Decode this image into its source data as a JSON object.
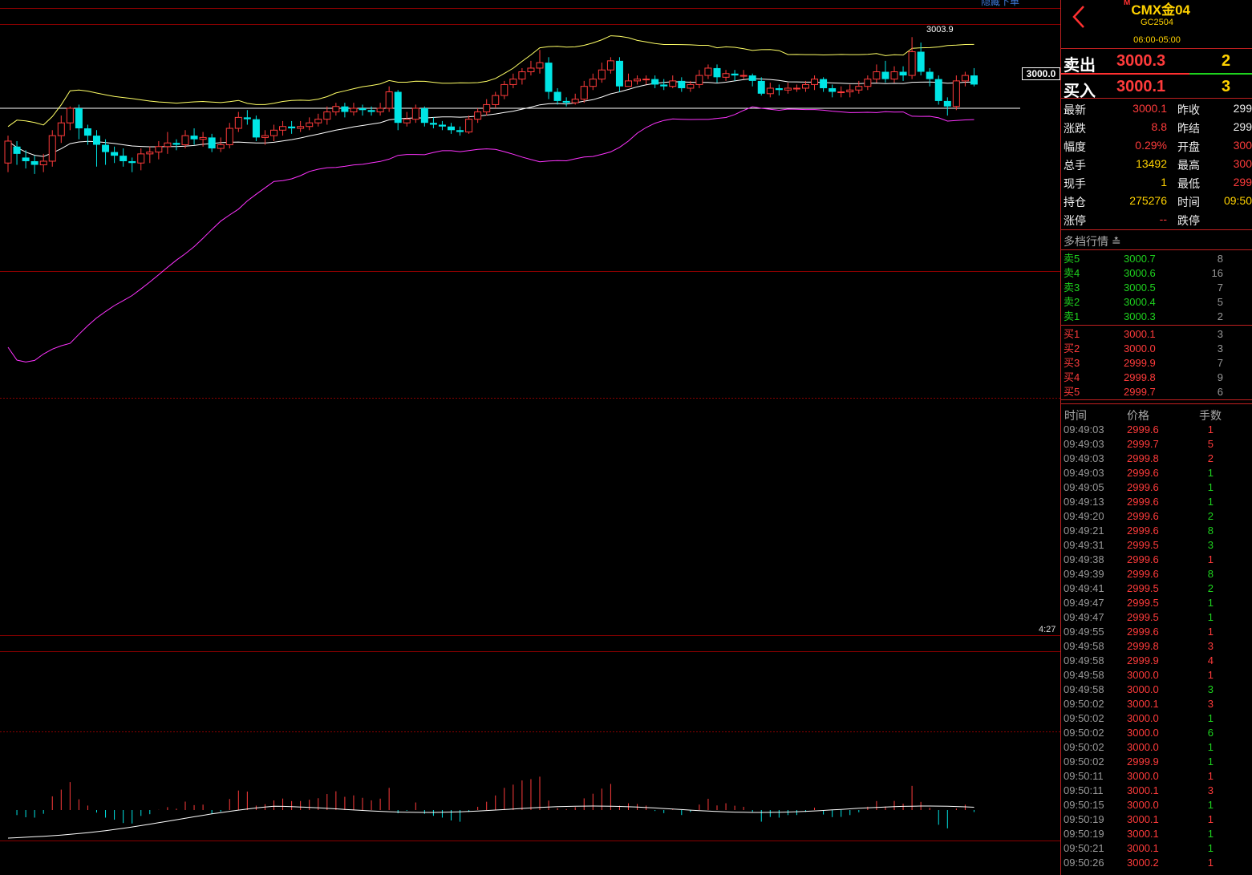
{
  "header": {
    "marker": "M",
    "name": "CMX金04",
    "code": "GC2504",
    "hours": "06:00-05:00"
  },
  "chart": {
    "hidden_orders_label": "隐藏下单",
    "high_label": "3003.9",
    "current_price_tag": "3000.0",
    "time_label": "4:27",
    "candles": [
      {
        "o": 2997.0,
        "c": 2998.2,
        "h": 2998.5,
        "l": 2996.5
      },
      {
        "o": 2997.9,
        "c": 2997.5,
        "h": 2998.2,
        "l": 2996.9
      },
      {
        "o": 2997.3,
        "c": 2997.1,
        "h": 2997.7,
        "l": 2996.7
      },
      {
        "o": 2997.1,
        "c": 2996.9,
        "h": 2997.4,
        "l": 2996.4
      },
      {
        "o": 2996.9,
        "c": 2997.1,
        "h": 2997.5,
        "l": 2996.5
      },
      {
        "o": 2997.1,
        "c": 2998.5,
        "h": 2998.8,
        "l": 2996.8
      },
      {
        "o": 2998.5,
        "c": 2999.2,
        "h": 2999.6,
        "l": 2998.1
      },
      {
        "o": 2999.2,
        "c": 3000.0,
        "h": 3000.1,
        "l": 2998.8
      },
      {
        "o": 3000.0,
        "c": 2998.9,
        "h": 3000.2,
        "l": 2998.3
      },
      {
        "o": 2998.9,
        "c": 2998.5,
        "h": 2999.1,
        "l": 2998.0
      },
      {
        "o": 2998.5,
        "c": 2998.0,
        "h": 2998.8,
        "l": 2996.8
      },
      {
        "o": 2998.0,
        "c": 2997.6,
        "h": 2998.3,
        "l": 2996.9
      },
      {
        "o": 2997.6,
        "c": 2997.4,
        "h": 2997.9,
        "l": 2997.0
      },
      {
        "o": 2997.4,
        "c": 2997.1,
        "h": 2997.8,
        "l": 2996.8
      },
      {
        "o": 2997.1,
        "c": 2997.0,
        "h": 2997.3,
        "l": 2996.5
      },
      {
        "o": 2997.0,
        "c": 2997.5,
        "h": 2997.8,
        "l": 2996.6
      },
      {
        "o": 2997.5,
        "c": 2997.6,
        "h": 2997.9,
        "l": 2997.0
      },
      {
        "o": 2997.6,
        "c": 2997.9,
        "h": 2998.2,
        "l": 2997.2
      },
      {
        "o": 2997.9,
        "c": 2998.1,
        "h": 2998.7,
        "l": 2997.5
      },
      {
        "o": 2998.1,
        "c": 2998.0,
        "h": 2998.3,
        "l": 2997.7
      },
      {
        "o": 2998.0,
        "c": 2998.5,
        "h": 2998.8,
        "l": 2997.8
      },
      {
        "o": 2998.5,
        "c": 2998.3,
        "h": 2998.9,
        "l": 2998.0
      },
      {
        "o": 2998.3,
        "c": 2998.4,
        "h": 2998.7,
        "l": 2997.9
      },
      {
        "o": 2998.4,
        "c": 2997.8,
        "h": 2998.6,
        "l": 2997.6
      },
      {
        "o": 2997.8,
        "c": 2998.0,
        "h": 2998.4,
        "l": 2997.6
      },
      {
        "o": 2998.0,
        "c": 2998.9,
        "h": 2999.2,
        "l": 2997.8
      },
      {
        "o": 2998.9,
        "c": 2999.5,
        "h": 2999.8,
        "l": 2998.7
      },
      {
        "o": 2999.5,
        "c": 2999.4,
        "h": 2999.9,
        "l": 2999.1
      },
      {
        "o": 2999.4,
        "c": 2998.4,
        "h": 2999.6,
        "l": 2998.2
      },
      {
        "o": 2998.4,
        "c": 2998.5,
        "h": 2998.8,
        "l": 2998.0
      },
      {
        "o": 2998.5,
        "c": 2998.8,
        "h": 2999.1,
        "l": 2998.2
      },
      {
        "o": 2998.8,
        "c": 2999.0,
        "h": 2999.3,
        "l": 2998.5
      },
      {
        "o": 2999.0,
        "c": 2998.9,
        "h": 2999.3,
        "l": 2998.6
      },
      {
        "o": 2998.9,
        "c": 2999.0,
        "h": 2999.3,
        "l": 2998.7
      },
      {
        "o": 2999.0,
        "c": 2999.2,
        "h": 2999.5,
        "l": 2998.8
      },
      {
        "o": 2999.2,
        "c": 2999.4,
        "h": 2999.7,
        "l": 2999.0
      },
      {
        "o": 2999.4,
        "c": 2999.8,
        "h": 3000.1,
        "l": 2999.1
      },
      {
        "o": 2999.8,
        "c": 3000.1,
        "h": 3000.3,
        "l": 2999.6
      },
      {
        "o": 3000.1,
        "c": 2999.8,
        "h": 3000.3,
        "l": 2999.5
      },
      {
        "o": 2999.8,
        "c": 3000.0,
        "h": 3000.3,
        "l": 2999.6
      },
      {
        "o": 3000.0,
        "c": 2999.9,
        "h": 3000.2,
        "l": 2999.6
      },
      {
        "o": 2999.9,
        "c": 2999.8,
        "h": 3000.1,
        "l": 2999.6
      },
      {
        "o": 2999.8,
        "c": 3000.0,
        "h": 3000.3,
        "l": 2999.6
      },
      {
        "o": 3000.0,
        "c": 3000.9,
        "h": 3001.2,
        "l": 2999.8
      },
      {
        "o": 3000.9,
        "c": 2999.2,
        "h": 3001.0,
        "l": 2998.8
      },
      {
        "o": 2999.2,
        "c": 2999.4,
        "h": 2999.8,
        "l": 2999.0
      },
      {
        "o": 2999.4,
        "c": 3000.0,
        "h": 3000.2,
        "l": 2999.2
      },
      {
        "o": 3000.0,
        "c": 2999.2,
        "h": 3000.1,
        "l": 2999.0
      },
      {
        "o": 2999.2,
        "c": 2999.1,
        "h": 2999.5,
        "l": 2998.9
      },
      {
        "o": 2999.1,
        "c": 2999.0,
        "h": 2999.3,
        "l": 2998.8
      },
      {
        "o": 2999.0,
        "c": 2998.8,
        "h": 2999.2,
        "l": 2998.6
      },
      {
        "o": 2998.8,
        "c": 2998.7,
        "h": 2999.0,
        "l": 2998.5
      },
      {
        "o": 2998.7,
        "c": 2999.4,
        "h": 2999.6,
        "l": 2998.6
      },
      {
        "o": 2999.4,
        "c": 2999.8,
        "h": 3000.0,
        "l": 2999.2
      },
      {
        "o": 2999.8,
        "c": 3000.2,
        "h": 3000.5,
        "l": 2999.6
      },
      {
        "o": 3000.2,
        "c": 3000.7,
        "h": 3000.9,
        "l": 3000.0
      },
      {
        "o": 3000.7,
        "c": 3001.3,
        "h": 3001.5,
        "l": 3000.5
      },
      {
        "o": 3001.3,
        "c": 3001.6,
        "h": 3001.9,
        "l": 3001.1
      },
      {
        "o": 3001.6,
        "c": 3002.0,
        "h": 3002.2,
        "l": 3001.3
      },
      {
        "o": 3002.0,
        "c": 3002.2,
        "h": 3002.6,
        "l": 3001.8
      },
      {
        "o": 3002.2,
        "c": 3002.5,
        "h": 3003.2,
        "l": 3001.9
      },
      {
        "o": 3002.5,
        "c": 3000.9,
        "h": 3002.8,
        "l": 3000.5
      },
      {
        "o": 3000.9,
        "c": 3000.4,
        "h": 3001.1,
        "l": 3000.2
      },
      {
        "o": 3000.4,
        "c": 3000.3,
        "h": 3000.6,
        "l": 3000.1
      },
      {
        "o": 3000.3,
        "c": 3000.5,
        "h": 3000.8,
        "l": 3000.2
      },
      {
        "o": 3000.5,
        "c": 3001.2,
        "h": 3001.5,
        "l": 3000.3
      },
      {
        "o": 3001.2,
        "c": 3001.6,
        "h": 3001.9,
        "l": 3001.0
      },
      {
        "o": 3001.6,
        "c": 3002.1,
        "h": 3002.5,
        "l": 3001.4
      },
      {
        "o": 3002.1,
        "c": 3002.6,
        "h": 3002.8,
        "l": 3001.9
      },
      {
        "o": 3002.6,
        "c": 3001.2,
        "h": 3002.8,
        "l": 3000.9
      },
      {
        "o": 3001.2,
        "c": 3001.5,
        "h": 3001.9,
        "l": 3001.2
      },
      {
        "o": 3001.5,
        "c": 3001.6,
        "h": 3001.8,
        "l": 3001.3
      },
      {
        "o": 3001.6,
        "c": 3001.6,
        "h": 3001.8,
        "l": 3001.3
      },
      {
        "o": 3001.6,
        "c": 3001.3,
        "h": 3001.8,
        "l": 3001.1
      },
      {
        "o": 3001.3,
        "c": 3001.2,
        "h": 3001.6,
        "l": 3001.0
      },
      {
        "o": 3001.2,
        "c": 3001.5,
        "h": 3001.8,
        "l": 3001.1
      },
      {
        "o": 3001.5,
        "c": 3001.1,
        "h": 3001.7,
        "l": 3000.9
      },
      {
        "o": 3001.1,
        "c": 3001.3,
        "h": 3001.5,
        "l": 3000.9
      },
      {
        "o": 3001.3,
        "c": 3001.8,
        "h": 3002.1,
        "l": 3001.1
      },
      {
        "o": 3001.8,
        "c": 3002.2,
        "h": 3002.4,
        "l": 3001.6
      },
      {
        "o": 3002.2,
        "c": 3001.7,
        "h": 3002.4,
        "l": 3001.4
      },
      {
        "o": 3001.7,
        "c": 3001.9,
        "h": 3002.1,
        "l": 3001.5
      },
      {
        "o": 3001.9,
        "c": 3001.8,
        "h": 3002.1,
        "l": 3001.5
      },
      {
        "o": 3001.8,
        "c": 3001.8,
        "h": 3002.1,
        "l": 3001.6
      },
      {
        "o": 3001.8,
        "c": 3001.5,
        "h": 3001.9,
        "l": 3001.2
      },
      {
        "o": 3001.5,
        "c": 3000.8,
        "h": 3001.7,
        "l": 3000.7
      },
      {
        "o": 3000.8,
        "c": 3001.1,
        "h": 3001.4,
        "l": 3000.6
      },
      {
        "o": 3001.1,
        "c": 3001.0,
        "h": 3001.3,
        "l": 3000.7
      },
      {
        "o": 3001.0,
        "c": 3001.1,
        "h": 3001.4,
        "l": 3000.8
      },
      {
        "o": 3001.1,
        "c": 3001.1,
        "h": 3001.3,
        "l": 3000.9
      },
      {
        "o": 3001.1,
        "c": 3001.3,
        "h": 3001.5,
        "l": 3000.9
      },
      {
        "o": 3001.3,
        "c": 3001.6,
        "h": 3001.8,
        "l": 3001.0
      },
      {
        "o": 3001.6,
        "c": 3001.1,
        "h": 3001.7,
        "l": 3000.9
      },
      {
        "o": 3001.1,
        "c": 3000.9,
        "h": 3001.3,
        "l": 3000.6
      },
      {
        "o": 3000.9,
        "c": 3000.9,
        "h": 3001.2,
        "l": 3000.6
      },
      {
        "o": 3000.9,
        "c": 3001.0,
        "h": 3001.3,
        "l": 3000.6
      },
      {
        "o": 3001.0,
        "c": 3001.2,
        "h": 3001.5,
        "l": 3000.8
      },
      {
        "o": 3001.2,
        "c": 3001.6,
        "h": 3001.8,
        "l": 3001.0
      },
      {
        "o": 3001.6,
        "c": 3002.0,
        "h": 3002.4,
        "l": 3001.4
      },
      {
        "o": 3002.0,
        "c": 3001.6,
        "h": 3002.6,
        "l": 3001.4
      },
      {
        "o": 3001.6,
        "c": 3002.0,
        "h": 3002.3,
        "l": 3001.4
      },
      {
        "o": 3002.0,
        "c": 3001.8,
        "h": 3002.3,
        "l": 3001.5
      },
      {
        "o": 3001.8,
        "c": 3003.1,
        "h": 3003.9,
        "l": 3001.6
      },
      {
        "o": 3003.1,
        "c": 3002.0,
        "h": 3003.6,
        "l": 3001.8
      },
      {
        "o": 3002.0,
        "c": 3001.6,
        "h": 3002.2,
        "l": 3001.2
      },
      {
        "o": 3001.6,
        "c": 3000.4,
        "h": 3001.8,
        "l": 3000.2
      },
      {
        "o": 3000.4,
        "c": 3000.1,
        "h": 3000.6,
        "l": 2999.6
      },
      {
        "o": 3000.1,
        "c": 3001.5,
        "h": 3001.8,
        "l": 2999.9
      },
      {
        "o": 3001.5,
        "c": 3001.8,
        "h": 3002.0,
        "l": 3001.2
      },
      {
        "o": 3001.8,
        "c": 3001.3,
        "h": 3002.2,
        "l": 3001.2
      }
    ]
  },
  "quote": {
    "sell_label": "卖出",
    "sell_price": "3000.3",
    "sell_qty": "2",
    "buy_label": "买入",
    "buy_price": "3000.1",
    "buy_qty": "3",
    "rows": [
      {
        "l1": "最新",
        "v1": "3000.1",
        "c1": "red",
        "l2": "昨收",
        "v2": "299",
        "c2": "wht"
      },
      {
        "l1": "涨跌",
        "v1": "8.8",
        "c1": "red",
        "l2": "昨结",
        "v2": "299",
        "c2": "wht"
      },
      {
        "l1": "幅度",
        "v1": "0.29%",
        "c1": "red",
        "l2": "开盘",
        "v2": "300",
        "c2": "red"
      },
      {
        "l1": "总手",
        "v1": "13492",
        "c1": "yel",
        "l2": "最高",
        "v2": "300",
        "c2": "red"
      },
      {
        "l1": "现手",
        "v1": "1",
        "c1": "yel",
        "l2": "最低",
        "v2": "299",
        "c2": "red"
      },
      {
        "l1": "持仓",
        "v1": "275276",
        "c1": "yel",
        "l2": "时间",
        "v2": "09:50",
        "c2": "yel"
      },
      {
        "l1": "涨停",
        "v1": "--",
        "c1": "red",
        "l2": "跌停",
        "v2": "",
        "c2": "wht"
      }
    ]
  },
  "depth": {
    "title": "多档行情",
    "asks": [
      {
        "label": "卖5",
        "price": "3000.7",
        "qty": "8"
      },
      {
        "label": "卖4",
        "price": "3000.6",
        "qty": "16"
      },
      {
        "label": "卖3",
        "price": "3000.5",
        "qty": "7"
      },
      {
        "label": "卖2",
        "price": "3000.4",
        "qty": "5"
      },
      {
        "label": "卖1",
        "price": "3000.3",
        "qty": "2"
      }
    ],
    "bids": [
      {
        "label": "买1",
        "price": "3000.1",
        "qty": "3"
      },
      {
        "label": "买2",
        "price": "3000.0",
        "qty": "3"
      },
      {
        "label": "买3",
        "price": "2999.9",
        "qty": "7"
      },
      {
        "label": "买4",
        "price": "2999.8",
        "qty": "9"
      },
      {
        "label": "买5",
        "price": "2999.7",
        "qty": "6"
      }
    ]
  },
  "ticks": {
    "headers": [
      "时间",
      "价格",
      "手数"
    ],
    "rows": [
      {
        "t": "09:49:03",
        "p": "2999.6",
        "q": "1",
        "qc": "red"
      },
      {
        "t": "09:49:03",
        "p": "2999.7",
        "q": "5",
        "qc": "red"
      },
      {
        "t": "09:49:03",
        "p": "2999.8",
        "q": "2",
        "qc": "red"
      },
      {
        "t": "09:49:03",
        "p": "2999.6",
        "q": "1",
        "qc": "grn"
      },
      {
        "t": "09:49:05",
        "p": "2999.6",
        "q": "1",
        "qc": "grn"
      },
      {
        "t": "09:49:13",
        "p": "2999.6",
        "q": "1",
        "qc": "grn"
      },
      {
        "t": "09:49:20",
        "p": "2999.6",
        "q": "2",
        "qc": "grn"
      },
      {
        "t": "09:49:21",
        "p": "2999.6",
        "q": "8",
        "qc": "grn"
      },
      {
        "t": "09:49:31",
        "p": "2999.5",
        "q": "3",
        "qc": "grn"
      },
      {
        "t": "09:49:38",
        "p": "2999.6",
        "q": "1",
        "qc": "red"
      },
      {
        "t": "09:49:39",
        "p": "2999.6",
        "q": "8",
        "qc": "grn"
      },
      {
        "t": "09:49:41",
        "p": "2999.5",
        "q": "2",
        "qc": "grn"
      },
      {
        "t": "09:49:47",
        "p": "2999.5",
        "q": "1",
        "qc": "grn"
      },
      {
        "t": "09:49:47",
        "p": "2999.5",
        "q": "1",
        "qc": "grn"
      },
      {
        "t": "09:49:55",
        "p": "2999.6",
        "q": "1",
        "qc": "red"
      },
      {
        "t": "09:49:58",
        "p": "2999.8",
        "q": "3",
        "qc": "red"
      },
      {
        "t": "09:49:58",
        "p": "2999.9",
        "q": "4",
        "qc": "red"
      },
      {
        "t": "09:49:58",
        "p": "3000.0",
        "q": "1",
        "qc": "red"
      },
      {
        "t": "09:49:58",
        "p": "3000.0",
        "q": "3",
        "qc": "grn"
      },
      {
        "t": "09:50:02",
        "p": "3000.1",
        "q": "3",
        "qc": "red"
      },
      {
        "t": "09:50:02",
        "p": "3000.0",
        "q": "1",
        "qc": "grn"
      },
      {
        "t": "09:50:02",
        "p": "3000.0",
        "q": "6",
        "qc": "grn"
      },
      {
        "t": "09:50:02",
        "p": "3000.0",
        "q": "1",
        "qc": "grn"
      },
      {
        "t": "09:50:02",
        "p": "2999.9",
        "q": "1",
        "qc": "grn"
      },
      {
        "t": "09:50:11",
        "p": "3000.0",
        "q": "1",
        "qc": "red"
      },
      {
        "t": "09:50:11",
        "p": "3000.1",
        "q": "3",
        "qc": "red"
      },
      {
        "t": "09:50:15",
        "p": "3000.0",
        "q": "1",
        "qc": "grn"
      },
      {
        "t": "09:50:19",
        "p": "3000.1",
        "q": "1",
        "qc": "red"
      },
      {
        "t": "09:50:19",
        "p": "3000.1",
        "q": "1",
        "qc": "grn"
      },
      {
        "t": "09:50:21",
        "p": "3000.1",
        "q": "1",
        "qc": "grn"
      },
      {
        "t": "09:50:26",
        "p": "3000.2",
        "q": "1",
        "qc": "red"
      }
    ]
  },
  "colors": {
    "up": "#ff3b3b",
    "down": "#00e5e5",
    "grid": "#8b0000",
    "boll_upper": "#ffff66",
    "boll_mid": "#ffffff",
    "boll_lower": "#ff33ff"
  }
}
